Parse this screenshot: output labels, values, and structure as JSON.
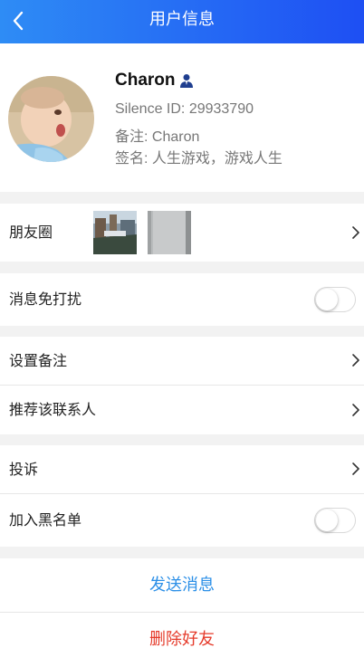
{
  "nav": {
    "title": "用户信息",
    "back_icon": "chevron-left-icon"
  },
  "profile": {
    "name": "Charon",
    "name_icon": "user-icon",
    "silence_id": "Silence ID: 29933790",
    "remark": "备注: Charon",
    "signature": "签名: 人生游戏，游戏人生"
  },
  "moments": {
    "label": "朋友圈"
  },
  "dnd": {
    "label": "消息免打扰",
    "enabled": false
  },
  "menu": {
    "set_remark": "设置备注",
    "recommend": "推荐该联系人",
    "complain": "投诉",
    "blacklist": "加入黑名单",
    "blacklist_enabled": false
  },
  "actions": {
    "send": "发送消息",
    "delete": "删除好友"
  },
  "colors": {
    "nav_start": "#2e8cf5",
    "nav_end": "#1e4ff3",
    "send": "#2b8fe7",
    "delete": "#e53a2a"
  }
}
